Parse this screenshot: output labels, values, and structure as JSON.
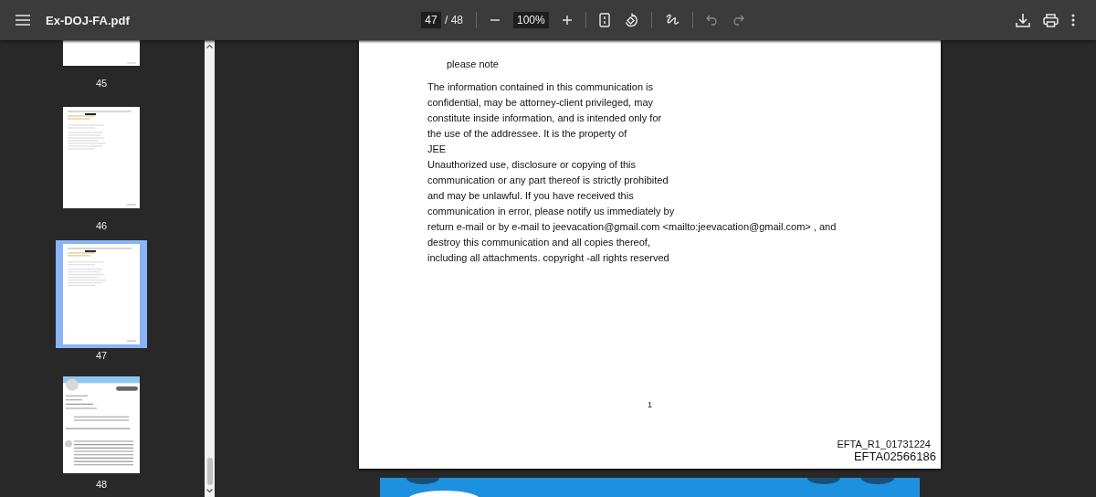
{
  "toolbar": {
    "title": "Ex-DOJ-FA.pdf",
    "page_input": "47",
    "page_total": "/ 48",
    "zoom": "100%",
    "undo_disabled": true,
    "redo_disabled": true
  },
  "thumbnails": [
    {
      "label": "45",
      "selected": false,
      "kind": "blank"
    },
    {
      "label": "46",
      "selected": false,
      "kind": "email"
    },
    {
      "label": "47",
      "selected": true,
      "kind": "email"
    },
    {
      "label": "48",
      "selected": false,
      "kind": "profile"
    }
  ],
  "page": {
    "greeting": "please note",
    "lines": [
      "The information contained in this communication is",
      "confidential, may be attorney-client privileged, may",
      "constitute inside information, and is intended only for",
      "the use of the addressee. It is the property of",
      "JEE",
      "Unauthorized use, disclosure or copying of this",
      "communication or any part thereof is strictly prohibited",
      "and may be unlawful. If you have received this",
      "communication in error, please notify us immediately by",
      "return e-mail or by e-mail to jeevacation@gmail.com <mailto:jeevacation@gmail.com> , and",
      "destroy this communication and all copies thereof,",
      "including all attachments. copyright -all rights reserved"
    ],
    "page_number": "1",
    "stamp_small": "EFTA_R1_01731224",
    "stamp_large": "EFTA02566186"
  }
}
